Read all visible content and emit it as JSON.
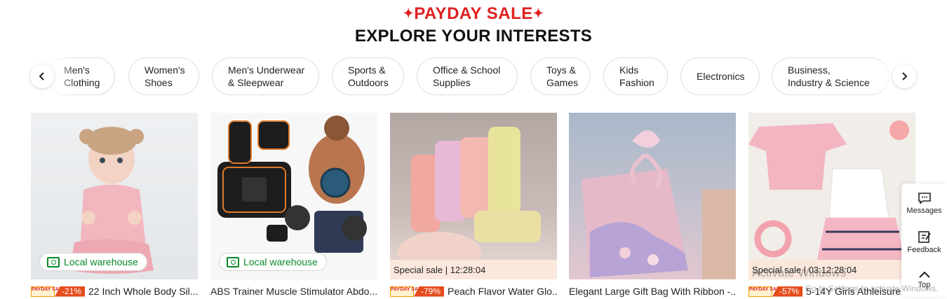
{
  "header": {
    "sale_label": "PAYDAY SALE",
    "title": "EXPLORE YOUR INTERESTS"
  },
  "nav": {
    "prev_icon": "chevron-left-icon",
    "next_icon": "chevron-right-icon"
  },
  "categories": [
    {
      "label": "Men's\nClothing"
    },
    {
      "label": "Women's\nShoes"
    },
    {
      "label": "Men's Underwear\n& Sleepwear"
    },
    {
      "label": "Sports &\nOutdoors"
    },
    {
      "label": "Office & School\nSupplies"
    },
    {
      "label": "Toys &\nGames"
    },
    {
      "label": "Kids\nFashion"
    },
    {
      "label": "Electronics"
    },
    {
      "label": "Business,\nIndustry & Science"
    }
  ],
  "products": [
    {
      "title": "22 Inch Whole Body Sil...",
      "badge": "Local warehouse",
      "payday_tag": "PAYDAY SALE",
      "discount": "-21%",
      "special": ""
    },
    {
      "title": "ABS Trainer Muscle Stimulator Abdo...",
      "badge": "Local warehouse",
      "payday_tag": "",
      "discount": "",
      "special": ""
    },
    {
      "title": "Peach Flavor Water Glo...",
      "badge": "",
      "payday_tag": "PAYDAY SALE",
      "discount": "-79%",
      "special": "Special sale | 12:28:04"
    },
    {
      "title": "Elegant Large Gift Bag With Ribbon -...",
      "badge": "",
      "payday_tag": "",
      "discount": "",
      "special": ""
    },
    {
      "title": "5-14Y Girls Athleisure",
      "badge": "",
      "payday_tag": "PAYDAY SALE",
      "discount": "-57%",
      "special": "Special sale | 03:12:28:04"
    }
  ],
  "sidebar": {
    "messages": "Messages",
    "feedback": "Feedback",
    "top": "Top"
  },
  "overlay": {
    "activate_title": "Activate Windows",
    "activate_sub": "Go to Settings to activate Windows."
  },
  "colors": {
    "accent": "#e02020",
    "discount": "#e64b1c",
    "local_warehouse": "#0a8a2a",
    "special_bg": "#fbe8dc"
  }
}
